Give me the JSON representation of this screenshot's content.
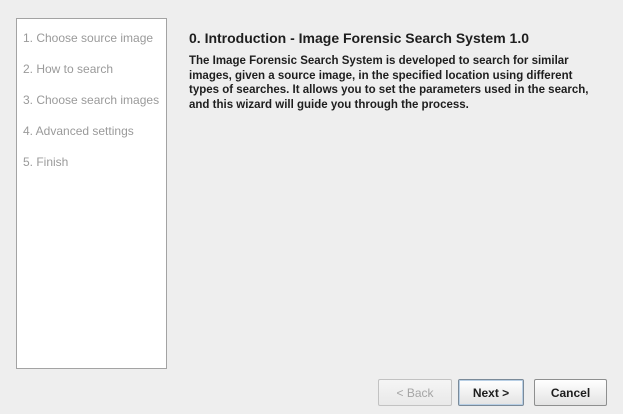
{
  "wizard": {
    "steps": [
      {
        "label": "1. Choose source image"
      },
      {
        "label": "2. How to search"
      },
      {
        "label": "3. Choose search images"
      },
      {
        "label": "4. Advanced settings"
      },
      {
        "label": "5. Finish"
      }
    ],
    "title": "0. Introduction - Image Forensic Search System 1.0",
    "description": "The Image Forensic Search System is developed to search for similar images, given a source image, in the specified location using different types of searches. It allows you to set the parameters used in the search, and this wizard will guide you through the process.",
    "buttons": {
      "back": "< Back",
      "next": "Next >",
      "cancel": "Cancel"
    }
  }
}
